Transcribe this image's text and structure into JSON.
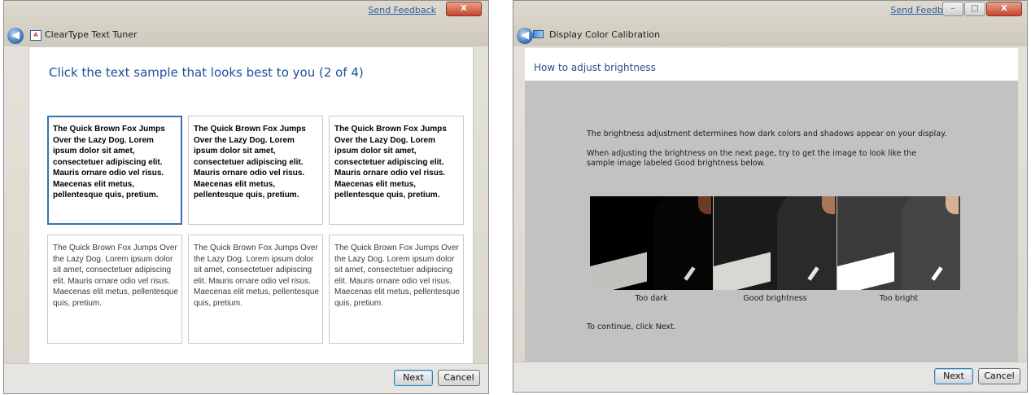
{
  "left_window": {
    "send_feedback": "Send Feedback",
    "close_glyph": "X",
    "back_glyph": "◀",
    "app_icon_glyph": "A",
    "title": "ClearType Text Tuner",
    "heading": "Click the text sample that looks best to you (2 of 4)",
    "samples": [
      {
        "text": "The Quick Brown Fox Jumps Over the Lazy Dog. Lorem ipsum dolor sit amet, consectetuer adipiscing elit. Mauris ornare odio vel risus. Maecenas elit metus, pellentesque quis, pretium.",
        "selected": true
      },
      {
        "text": "The Quick Brown Fox Jumps Over the Lazy Dog. Lorem ipsum dolor sit amet, consectetuer adipiscing elit. Mauris ornare odio vel risus. Maecenas elit metus, pellentesque quis, pretium.",
        "selected": false
      },
      {
        "text": "The Quick Brown Fox Jumps Over the Lazy Dog. Lorem ipsum dolor sit amet, consectetuer adipiscing elit. Mauris ornare odio vel risus. Maecenas elit metus, pellentesque quis, pretium.",
        "selected": false
      },
      {
        "text": "The Quick Brown Fox Jumps Over the Lazy Dog. Lorem ipsum dolor sit amet, consectetuer adipiscing elit. Mauris ornare odio vel risus. Maecenas elit metus, pellentesque quis, pretium.",
        "selected": false
      },
      {
        "text": "The Quick Brown Fox Jumps Over the Lazy Dog. Lorem ipsum dolor sit amet, consectetuer adipiscing elit. Mauris ornare odio vel risus. Maecenas elit metus, pellentesque quis, pretium.",
        "selected": false
      },
      {
        "text": "The Quick Brown Fox Jumps Over the Lazy Dog. Lorem ipsum dolor sit amet, consectetuer adipiscing elit. Mauris ornare odio vel risus. Maecenas elit metus, pellentesque quis, pretium.",
        "selected": false
      }
    ],
    "next_label": "Next",
    "cancel_label": "Cancel"
  },
  "right_window": {
    "send_feedback": "Send Feedback",
    "minimize_glyph": "–",
    "maximize_glyph": "□",
    "close_glyph": "X",
    "back_glyph": "◀",
    "title": "Display Color Calibration",
    "heading": "How to adjust brightness",
    "para1": "The brightness adjustment determines how dark colors and shadows appear on your display.",
    "para2": "When adjusting the brightness on the next page, try to get the image to look like the sample image labeled Good brightness below.",
    "captions": [
      "Too dark",
      "Good brightness",
      "Too bright"
    ],
    "continue_text": "To continue, click Next.",
    "next_label": "Next",
    "cancel_label": "Cancel"
  },
  "colors": {
    "heading_blue": "#1e4e9c",
    "link_blue": "#2a5ea8",
    "selected_border": "#3a6fb7",
    "gray_panel": "#c1c2c1"
  }
}
